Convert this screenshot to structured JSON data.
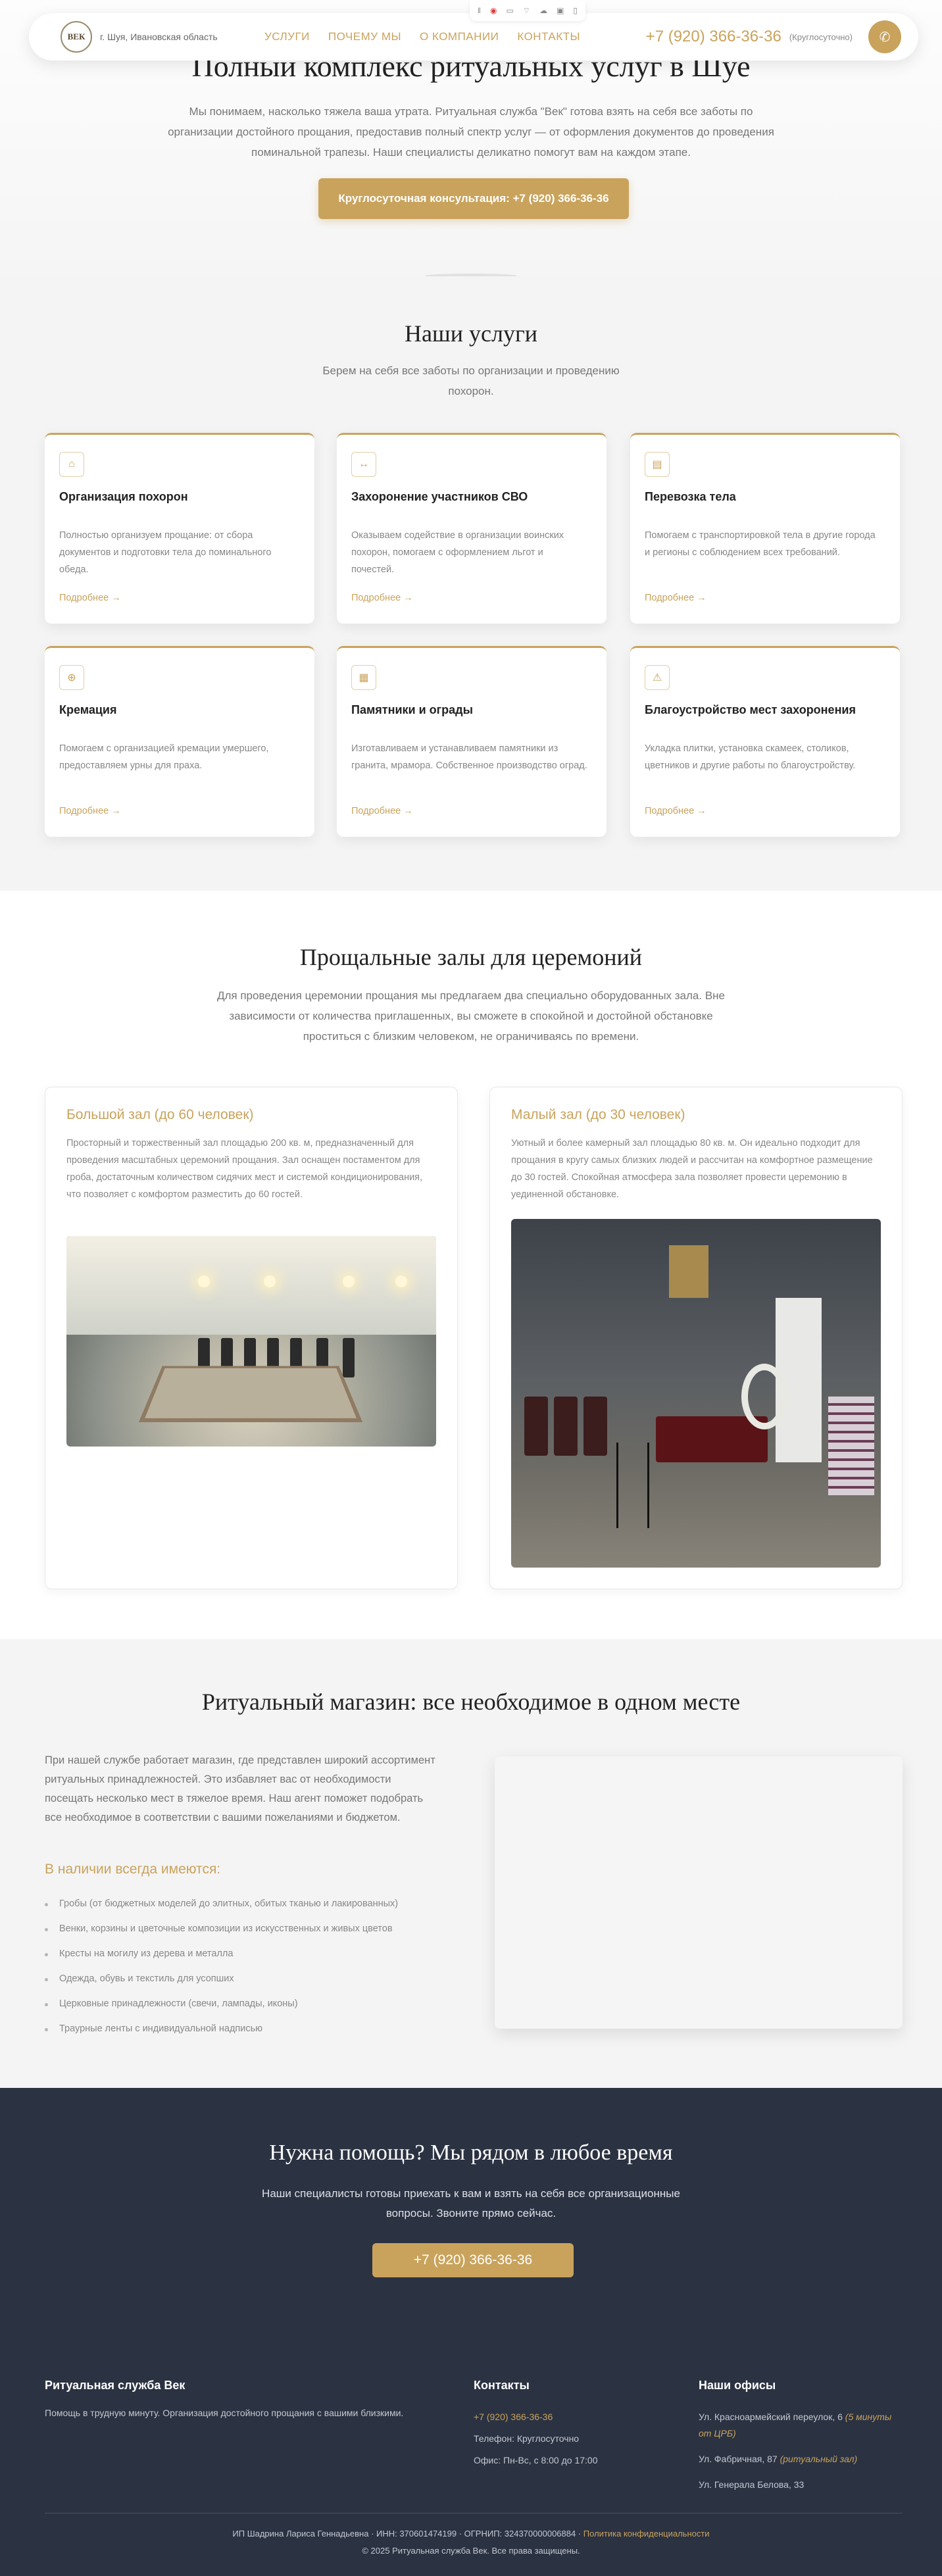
{
  "header": {
    "location": "г. Шуя, Ивановская область",
    "logo_text": "ВЕК",
    "nav": [
      "УСЛУГИ",
      "ПОЧЕМУ МЫ",
      "О КОМПАНИИ",
      "КОНТАКТЫ"
    ],
    "phone": "+7 (920) 366-36-36",
    "phone_note": "(Круглосуточно)"
  },
  "hero": {
    "title": "Полный комплекс ритуальных услуг в Шуе",
    "text": "Мы понимаем, насколько тяжела ваша утрата. Ритуальная служба \"Век\" готова взять на себя все заботы по организации достойного прощания, предоставив полный спектр услуг — от оформления документов до проведения поминальной трапезы. Наши специалисты деликатно помогут вам на каждом этапе.",
    "button": "Круглосуточная консультация: +7 (920) 366-36-36"
  },
  "services": {
    "title": "Наши услуги",
    "subtitle": "Берем на себя все заботы по организации и проведению похорон.",
    "more": "Подробнее →",
    "cards": [
      {
        "icon": "coffin-icon",
        "title": "Организация похорон",
        "text": "Полностью организуем прощание: от сбора документов и подготовки тела до поминального обеда."
      },
      {
        "icon": "arrows-icon",
        "title": "Захоронение участников СВО",
        "text": "Оказываем содействие в организации воинских похорон, помогаем с оформлением льгот и почестей."
      },
      {
        "icon": "truck-icon",
        "title": "Перевозка тела",
        "text": "Помогаем с транспортировкой тела в другие города и регионы с соблюдением всех требований."
      },
      {
        "icon": "urn-icon",
        "title": "Кремация",
        "text": "Помогаем с организацией кремации умершего, предоставляем урны для праха."
      },
      {
        "icon": "monument-icon",
        "title": "Памятники и ограды",
        "text": "Изготавливаем и устанавливаем памятники из гранита, мрамора. Собственное производство оград."
      },
      {
        "icon": "landscape-icon",
        "title": "Благоустройство мест захоронения",
        "text": "Укладка плитки, установка скамеек, столиков, цветников и другие работы по благоустройству."
      }
    ]
  },
  "halls": {
    "title": "Прощальные залы для церемоний",
    "subtitle": "Для проведения церемонии прощания мы предлагаем два специально оборудованных зала. Вне зависимости от количества приглашенных, вы сможете в спокойной и достойной обстановке проститься с близким человеком, не ограничиваясь по времени.",
    "items": [
      {
        "title": "Большой зал (до 60 человек)",
        "text": "Просторный и торжественный зал площадью 200 кв. м, предназначенный для проведения масштабных церемоний прощания. Зал оснащен постаментом для гроба, достаточным количеством сидячих мест и системой кондиционирования, что позволяет с комфортом разместить до 60 гостей."
      },
      {
        "title": "Малый зал (до 30 человек)",
        "text": "Уютный и более камерный зал площадью 80 кв. м. Он идеально подходит для прощания в кругу самых близких людей и рассчитан на комфортное размещение до 30 гостей. Спокойная атмосфера зала позволяет провести церемонию в уединенной обстановке."
      }
    ]
  },
  "shop": {
    "title": "Ритуальный магазин: все необходимое в одном месте",
    "intro": "При нашей службе работает магазин, где представлен широкий ассортимент ритуальных принадлежностей. Это избавляет вас от необходимости посещать несколько мест в тяжелое время. Наш агент поможет подобрать все необходимое в соответствии с вашими пожеланиями и бюджетом.",
    "list_title": "В наличии всегда имеются:",
    "items": [
      "Гробы (от бюджетных моделей до элитных, обитых тканью и лакированных)",
      "Венки, корзины и цветочные композиции из искусственных и живых цветов",
      "Кресты на могилу из дерева и металла",
      "Одежда, обувь и текстиль для усопших",
      "Церковные принадлежности (свечи, лампады, иконы)",
      "Траурные ленты с индивидуальной надписью"
    ]
  },
  "cta": {
    "title": "Нужна помощь? Мы рядом в любое время",
    "text": "Наши специалисты готовы приехать к вам и взять на себя все организационные вопросы. Звоните прямо сейчас.",
    "button": "+7 (920) 366-36-36"
  },
  "footer": {
    "brand_title": "Ритуальная служба Век",
    "brand_text": "Помощь в трудную минуту. Организация достойного прощания с вашими близкими.",
    "contacts_title": "Контакты",
    "phone": "+7 (920) 366-36-36",
    "phone_hours": "Телефон: Круглосуточно",
    "office_hours": "Офис: Пн-Вс, с 8:00 до 17:00",
    "offices_title": "Наши офисы",
    "office1": "Ул. Красноармейский переулок, 6",
    "office1_note": "(5 минуты от ЦРБ)",
    "office2": "Ул. Фабричная, 87",
    "office2_note": "(ритуальный зал)",
    "office3": "Ул. Генерала Белова, 33",
    "legal": "ИП Шадрина Лариса Геннадьевна · ИНН: 370601474199 · ОГРНИП: 324370000006884 ·",
    "privacy": "Политика конфиденциальности",
    "copyright": "© 2025 Ритуальная служба Век. Все права защищены."
  }
}
